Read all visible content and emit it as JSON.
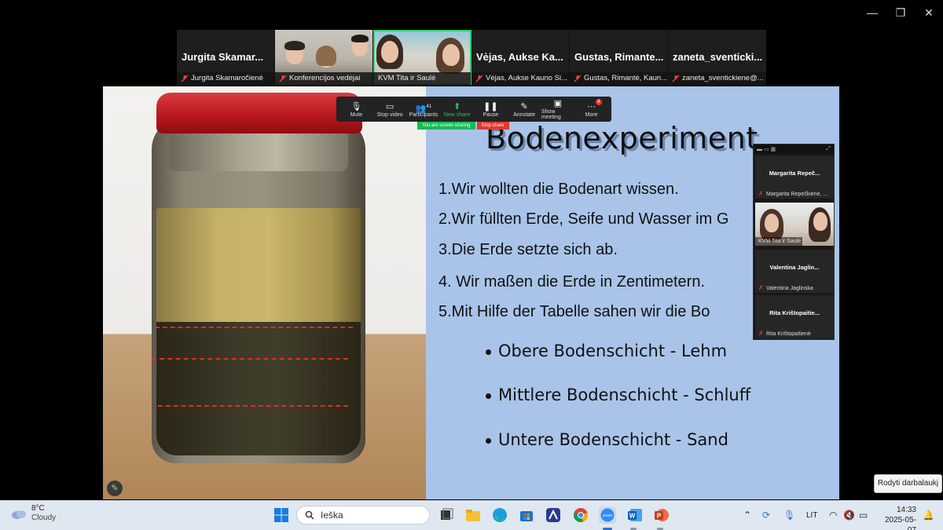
{
  "window": {
    "minimize": "—",
    "restore": "❐",
    "close": "✕"
  },
  "strip": [
    {
      "big": "Jurgita Skamar...",
      "caption": "Jurgita Skamaročienė",
      "video": false
    },
    {
      "big": "",
      "caption": "Konferencijos vedėjai",
      "video": true
    },
    {
      "big": "",
      "caption": "KVM Tita ir Saulė",
      "video": true,
      "active": true
    },
    {
      "big": "Vėjas, Aukse Ka...",
      "caption": "Vėjas, Aukse Kauno Si...",
      "video": false
    },
    {
      "big": "Gustas, Rimante...",
      "caption": "Gustas, Rimantė, Kaun...",
      "video": false
    },
    {
      "big": "zaneta_sventicki...",
      "caption": "zaneta_sventickiene@...",
      "video": false
    }
  ],
  "toolbar": {
    "mute": "Mute",
    "stop_video": "Stop video",
    "participants": "Participants",
    "participants_count": "41",
    "new_share": "New share",
    "pause": "Pause",
    "annotate": "Annotate",
    "show_meeting": "Show meeting",
    "more": "More",
    "more_badge": "4",
    "screen_sharing": "You are screen sharing",
    "stop_share": "Stop share"
  },
  "slide": {
    "title": "Bodenexperiment",
    "points": [
      "1.Wir wollten die Bodenart wissen.",
      "2.Wir füllten Erde, Seife und Wasser im G",
      "3.Die Erde setzte sich ab.",
      "4. Wir maßen die Erde in  Zentimetern.",
      "5.Mit Hilfe der Tabelle sahen wir die Bo"
    ],
    "bullets": [
      "Obere Bodenschicht - Lehm",
      "Mittlere Bodenschicht - Schluff",
      "Untere Bodenschicht - Sand"
    ]
  },
  "panel": [
    {
      "name": "Margarita Repeč...",
      "caption": "Margarita Repečkienė, ...",
      "video": false
    },
    {
      "name": "",
      "caption": "KVM Tita ir Saulė",
      "video": true
    },
    {
      "name": "Valentina Jaglin...",
      "caption": "Valentina Jaglinska",
      "video": false
    },
    {
      "name": "Rita Krištopaitie...",
      "caption": "Rita Krištopaitienė",
      "video": false
    }
  ],
  "tooltip": "Rodyti darbalaukį",
  "taskbar": {
    "temp": "8°C",
    "weather": "Cloudy",
    "search": "Ieška",
    "lang": "LIT",
    "time": "14:33",
    "date": "2025-05-07"
  }
}
